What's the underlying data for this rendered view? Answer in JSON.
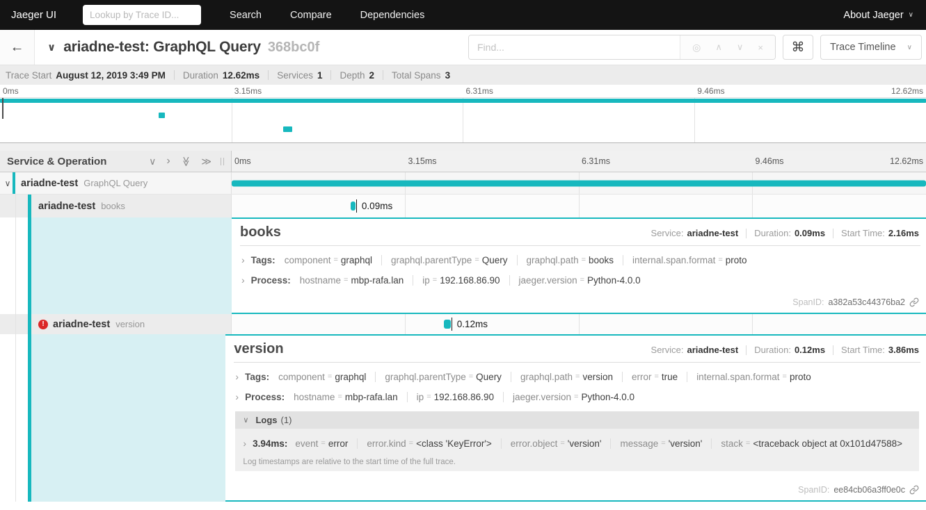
{
  "icons": {
    "back": "←",
    "title_caret": "∨",
    "caret_small": "∨",
    "chevron_down": "∨",
    "chevron_right": "›",
    "dbl_chevron": "≫",
    "command": "⌘",
    "target": "◎",
    "arrow_up": "∧",
    "arrow_down": "∨",
    "close": "×",
    "error_mark": "!"
  },
  "colors": {
    "accent": "#17b8be",
    "error": "#db2828",
    "detail_highlight": "#d7f0f3",
    "topnav_bg": "#141414"
  },
  "topnav": {
    "brand": "Jaeger UI",
    "trace_lookup_placeholder": "Lookup by Trace ID...",
    "items": [
      "Search",
      "Compare",
      "Dependencies"
    ],
    "about": "About Jaeger"
  },
  "trace_header": {
    "title": "ariadne-test: GraphQL Query",
    "trace_id_short": "368bc0f",
    "find_placeholder": "Find...",
    "view_select": "Trace Timeline"
  },
  "meta": {
    "items": [
      {
        "label": "Trace Start",
        "value": "August 12, 2019 3:49 PM"
      },
      {
        "label": "Duration",
        "value": "12.62ms"
      },
      {
        "label": "Services",
        "value": "1"
      },
      {
        "label": "Depth",
        "value": "2"
      },
      {
        "label": "Total Spans",
        "value": "3"
      }
    ]
  },
  "table": {
    "header": "Service & Operation"
  },
  "timeline": {
    "total_ms": 12.62,
    "ticks": [
      "0ms",
      "3.15ms",
      "6.31ms",
      "9.46ms",
      "12.62ms"
    ],
    "spans": [
      {
        "service": "ariadne-test",
        "operation": "GraphQL Query",
        "start_ms": 0,
        "duration_ms": 12.62
      },
      {
        "service": "ariadne-test",
        "operation": "books",
        "start_ms": 2.16,
        "duration_ms": 0.09,
        "duration_label": "0.09ms"
      },
      {
        "service": "ariadne-test",
        "operation": "version",
        "start_ms": 3.86,
        "duration_ms": 0.12,
        "duration_label": "0.12ms",
        "has_error": true
      }
    ]
  },
  "details": [
    {
      "title": "books",
      "summary": {
        "service_label": "Service:",
        "service": "ariadne-test",
        "duration_label": "Duration:",
        "duration": "0.09ms",
        "start_label": "Start Time:",
        "start": "2.16ms"
      },
      "tags_label": "Tags:",
      "tags": [
        {
          "key": "component",
          "value": "graphql"
        },
        {
          "key": "graphql.parentType",
          "value": "Query"
        },
        {
          "key": "graphql.path",
          "value": "books"
        },
        {
          "key": "internal.span.format",
          "value": "proto"
        }
      ],
      "process_label": "Process:",
      "process": [
        {
          "key": "hostname",
          "value": "mbp-rafa.lan"
        },
        {
          "key": "ip",
          "value": "192.168.86.90"
        },
        {
          "key": "jaeger.version",
          "value": "Python-4.0.0"
        }
      ],
      "spanid_label": "SpanID:",
      "span_id": "a382a53c44376ba2"
    },
    {
      "title": "version",
      "summary": {
        "service_label": "Service:",
        "service": "ariadne-test",
        "duration_label": "Duration:",
        "duration": "0.12ms",
        "start_label": "Start Time:",
        "start": "3.86ms"
      },
      "tags_label": "Tags:",
      "tags": [
        {
          "key": "component",
          "value": "graphql"
        },
        {
          "key": "graphql.parentType",
          "value": "Query"
        },
        {
          "key": "graphql.path",
          "value": "version"
        },
        {
          "key": "error",
          "value": "true"
        },
        {
          "key": "internal.span.format",
          "value": "proto"
        }
      ],
      "process_label": "Process:",
      "process": [
        {
          "key": "hostname",
          "value": "mbp-rafa.lan"
        },
        {
          "key": "ip",
          "value": "192.168.86.90"
        },
        {
          "key": "jaeger.version",
          "value": "Python-4.0.0"
        }
      ],
      "logs": {
        "title": "Logs",
        "count": "(1)",
        "entry_time": "3.94ms:",
        "fields": [
          {
            "key": "event",
            "value": "error"
          },
          {
            "key": "error.kind",
            "value": "<class 'KeyError'>"
          },
          {
            "key": "error.object",
            "value": "'version'"
          },
          {
            "key": "message",
            "value": "'version'"
          },
          {
            "key": "stack",
            "value": "<traceback object at 0x101d47588>"
          }
        ],
        "note": "Log timestamps are relative to the start time of the full trace."
      },
      "spanid_label": "SpanID:",
      "span_id": "ee84cb06a3ff0e0c"
    }
  ],
  "misc": {
    "eq": "="
  }
}
